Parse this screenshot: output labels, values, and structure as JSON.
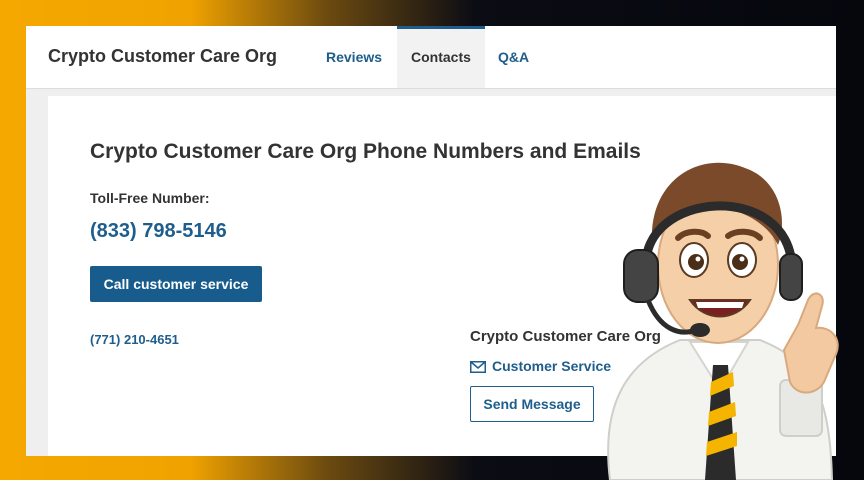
{
  "header": {
    "brand": "Crypto Customer Care Org",
    "tabs": [
      "Reviews",
      "Contacts",
      "Q&A"
    ],
    "active_tab": "Contacts"
  },
  "main": {
    "heading": "Crypto Customer Care Org Phone Numbers and Emails",
    "toll_free_label": "Toll-Free Number:",
    "toll_free_number": "(833) 798-5146",
    "call_button": "Call customer service",
    "alt_number": "(771) 210-4651",
    "org_name": "Crypto Customer Care Org",
    "cs_link": "Customer Service",
    "send_button": "Send Message"
  },
  "colors": {
    "accent": "#1f5e8c",
    "background_gold": "#f5a800",
    "background_dark": "#05070d"
  },
  "icons": [
    "envelope-icon",
    "customer-support-agent-illustration"
  ]
}
